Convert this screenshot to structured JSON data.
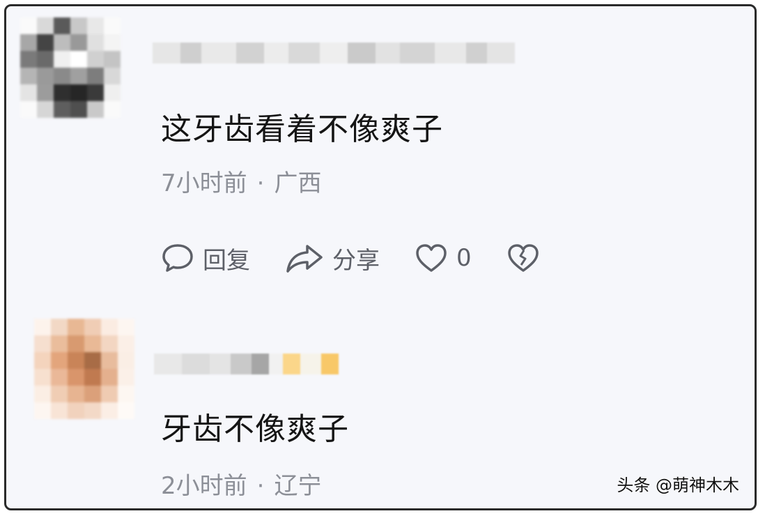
{
  "comments": [
    {
      "text": "这牙齿看着不像爽子",
      "time": "7小时前",
      "separator": "·",
      "location": "广西",
      "reply_label": "回复",
      "share_label": "分享",
      "like_count": "0"
    },
    {
      "text": "牙齿不像爽子",
      "time": "2小时前",
      "separator": "·",
      "location": "辽宁"
    }
  ],
  "watermark": "头条 @萌神木木",
  "icons": {
    "reply": "speech-bubble-icon",
    "share": "share-arrow-icon",
    "like": "heart-icon",
    "dislike": "broken-heart-icon"
  },
  "colors": {
    "frame_bg": "#f6f7fb",
    "text": "#151515",
    "meta": "#8c8f97",
    "action": "#5d6068"
  }
}
